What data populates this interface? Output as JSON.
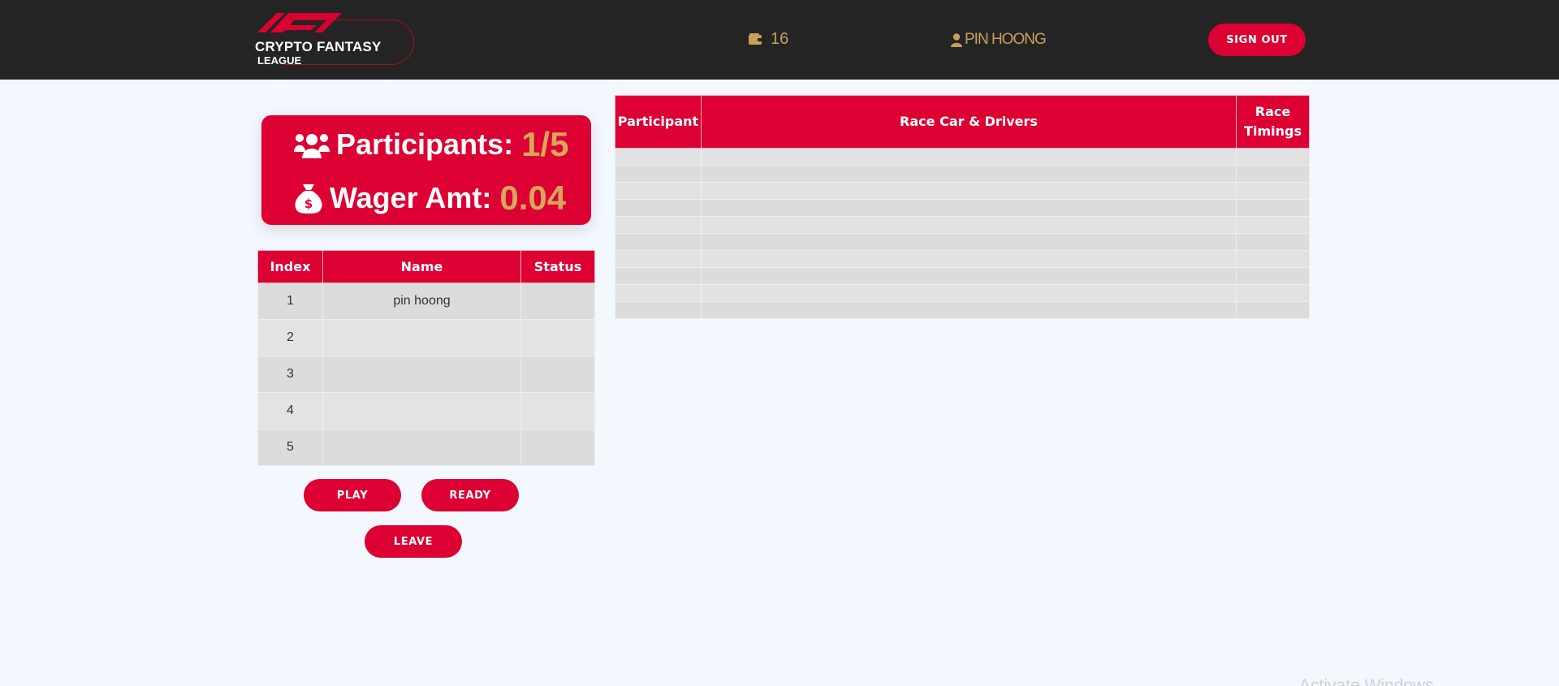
{
  "brand": {
    "line1": "CRYPTO FANTASY",
    "line2": "LEAGUE",
    "accent": "#dc0033"
  },
  "navbar": {
    "wallet_icon": "wallet-icon",
    "wallet_balance": "16",
    "user_icon": "user-icon",
    "username": "pin hoong",
    "sign_out_label": "SIGN OUT"
  },
  "stats": {
    "participants_icon": "group-icon",
    "participants_label": "Participants:",
    "participants_value": "1/5",
    "wager_icon": "money-bag-icon",
    "wager_label": "Wager Amt:",
    "wager_value": "0.04"
  },
  "participants_table": {
    "headers": [
      "Index",
      "Name",
      "Status"
    ],
    "rows": [
      {
        "index": "1",
        "name": "pin hoong",
        "status": ""
      },
      {
        "index": "2",
        "name": "",
        "status": ""
      },
      {
        "index": "3",
        "name": "",
        "status": ""
      },
      {
        "index": "4",
        "name": "",
        "status": ""
      },
      {
        "index": "5",
        "name": "",
        "status": ""
      }
    ]
  },
  "race_table": {
    "headers": [
      "Participant",
      "Race Car & Drivers",
      "Race Timings"
    ],
    "row_count": 10
  },
  "actions": {
    "play_label": "PLAY",
    "ready_label": "READY",
    "leave_label": "LEAVE"
  },
  "os_watermark": "Activate Windows"
}
